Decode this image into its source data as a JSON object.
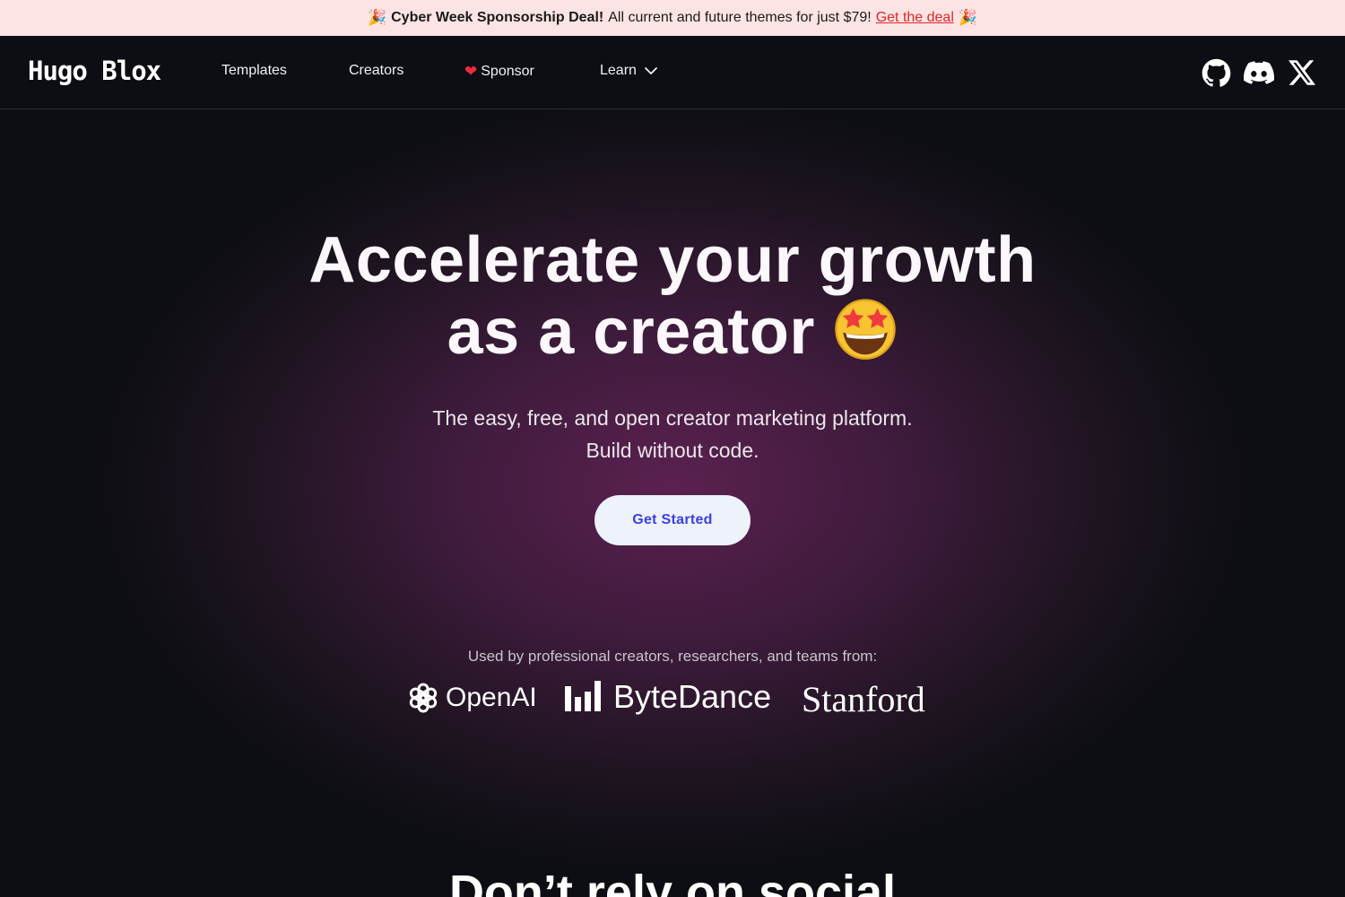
{
  "promo": {
    "party_emoji": "🎉",
    "title": "Cyber Week Sponsorship Deal!",
    "text": "All current and future themes for just $79!",
    "link": "Get the deal"
  },
  "nav": {
    "logo": "Hugo Blox",
    "items": [
      {
        "label": "Templates"
      },
      {
        "label": "Creators"
      },
      {
        "label": "Sponsor",
        "icon": "heart-icon"
      },
      {
        "label": "Learn",
        "icon": "chevron-down-icon"
      }
    ],
    "social": [
      "github-icon",
      "discord-icon",
      "x-icon"
    ]
  },
  "hero": {
    "headline_line1": "Accelerate your growth",
    "headline_line2": "as a creator",
    "emoji": "star-struck-emoji",
    "sub_line1": "The easy, free, and open creator marketing platform.",
    "sub_line2": "Build without code.",
    "cta": "Get Started",
    "used_by": "Used by professional creators, researchers, and teams from:",
    "logos": [
      "OpenAI",
      "ByteDance",
      "Stanford"
    ]
  },
  "next_section": {
    "heading": "Don’t rely on social"
  },
  "colors": {
    "promo_bg": "#fde4e4",
    "link": "#dc2626",
    "page_bg": "#0d0e13",
    "hero_glow": "#5b2150",
    "cta_bg": "#eef2fb",
    "cta_text": "#3b3fe0"
  }
}
